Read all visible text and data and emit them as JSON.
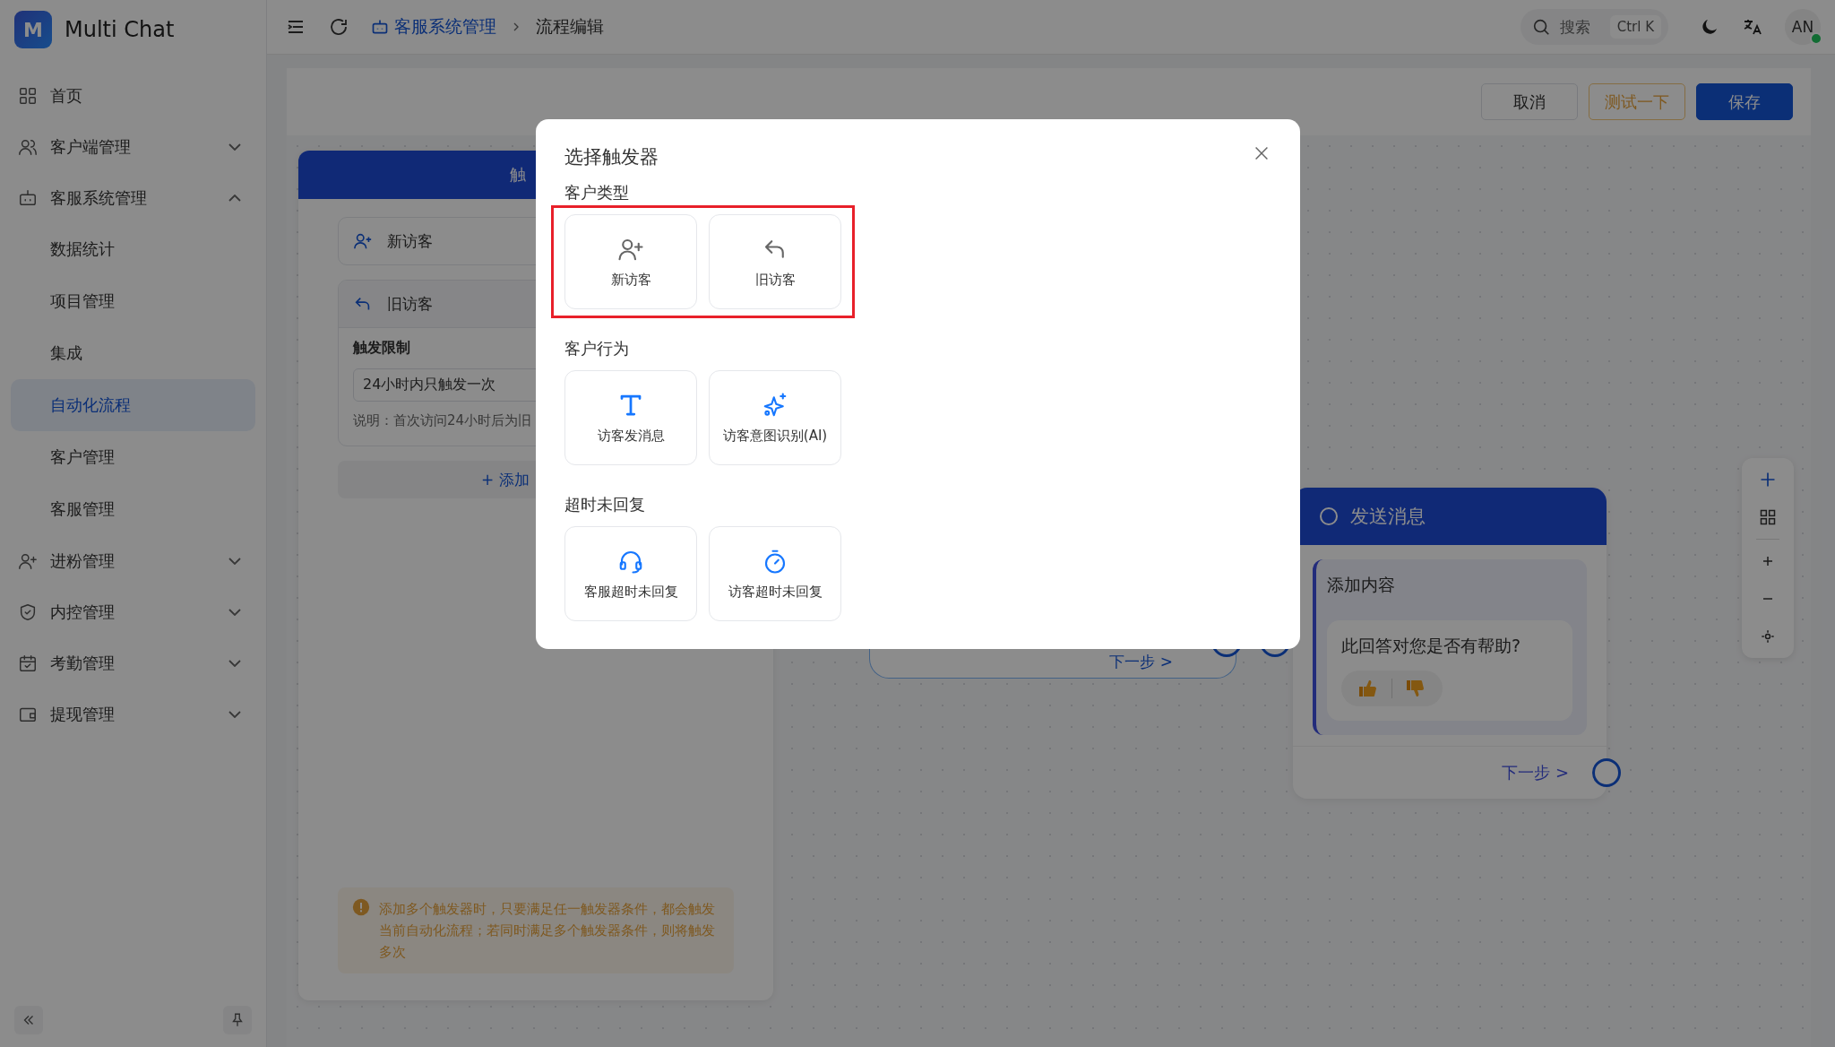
{
  "app": {
    "name": "Multi Chat",
    "logo_letter": "M"
  },
  "sidebar": {
    "items": [
      {
        "label": "首页",
        "selected": false
      },
      {
        "label": "客户端管理",
        "selected": false,
        "expanded": false
      },
      {
        "label": "客服系统管理",
        "selected": false,
        "expanded": true,
        "children": [
          {
            "label": "数据统计",
            "selected": false
          },
          {
            "label": "项目管理",
            "selected": false
          },
          {
            "label": "集成",
            "selected": false
          },
          {
            "label": "自动化流程",
            "selected": true
          },
          {
            "label": "客户管理",
            "selected": false
          },
          {
            "label": "客服管理",
            "selected": false
          }
        ]
      },
      {
        "label": "进粉管理",
        "selected": false,
        "expanded": false
      },
      {
        "label": "内控管理",
        "selected": false,
        "expanded": false
      },
      {
        "label": "考勤管理",
        "selected": false,
        "expanded": false
      },
      {
        "label": "提现管理",
        "selected": false,
        "expanded": false
      }
    ]
  },
  "topbar": {
    "breadcrumb": [
      {
        "label": "客服系统管理"
      },
      {
        "label": "流程编辑"
      }
    ],
    "search": {
      "placeholder": "搜索",
      "shortcut": "Ctrl K"
    },
    "avatar": {
      "initials": "AN",
      "online": true
    }
  },
  "toolbar": {
    "buttons": [
      {
        "label": "取消",
        "kind": "default"
      },
      {
        "label": "测试一下",
        "kind": "warning"
      },
      {
        "label": "保存",
        "kind": "primary"
      }
    ]
  },
  "trigger_panel": {
    "title": "触",
    "triggers": [
      {
        "label": "新访客",
        "expanded": false
      },
      {
        "label": "旧访客",
        "expanded": true,
        "limit_label": "触发限制",
        "limit_value": "24小时内只触发一次",
        "note": "说明：首次访问24小时后为旧"
      }
    ],
    "add_button": "+ 添加",
    "notice": "添加多个触发器时，只要满足任一触发器条件，都会触发当前自动化流程；若同时满足多个触发器条件，则将触发多次"
  },
  "canvas": {
    "middle_node": {
      "next": "下一步 >"
    },
    "message_node": {
      "title": "发送消息",
      "content_label": "添加内容",
      "question": "此回答对您是否有帮助?",
      "next": "下一步 >"
    }
  },
  "modal": {
    "title": "选择触发器",
    "sections": [
      {
        "title": "客户类型",
        "highlighted": true,
        "options": [
          {
            "label": "新访客"
          },
          {
            "label": "旧访客"
          }
        ]
      },
      {
        "title": "客户行为",
        "highlighted": false,
        "options": [
          {
            "label": "访客发消息"
          },
          {
            "label": "访客意图识别(AI)"
          }
        ]
      },
      {
        "title": "超时未回复",
        "highlighted": false,
        "options": [
          {
            "label": "客服超时未回复"
          },
          {
            "label": "访客超时未回复"
          }
        ]
      }
    ]
  }
}
